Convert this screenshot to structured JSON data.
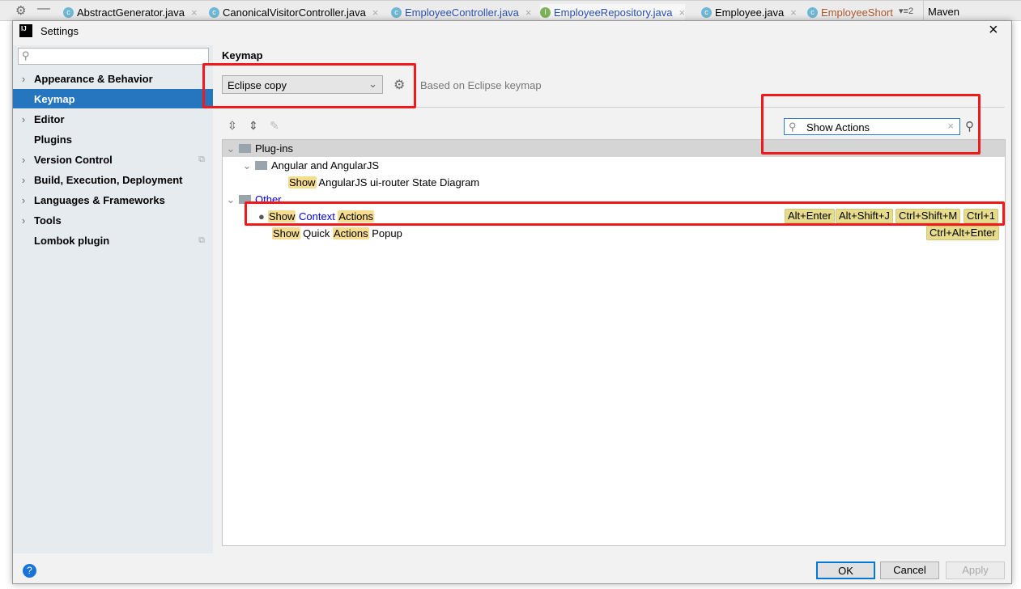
{
  "ide_tabs": [
    {
      "name": "AbstractGenerator.java",
      "kind": "C",
      "color": "#000000"
    },
    {
      "name": "CanonicalVisitorController.java",
      "kind": "C",
      "color": "#000000"
    },
    {
      "name": "EmployeeController.java",
      "kind": "C",
      "color": "#2a4fb5"
    },
    {
      "name": "EmployeeRepository.java",
      "kind": "I",
      "color": "#2a4fb5"
    },
    {
      "name": "Employee.java",
      "kind": "C",
      "color": "#000000"
    },
    {
      "name": "EmployeeShort",
      "kind": "C",
      "color": "#b0552a"
    }
  ],
  "tab_overflow": "▾≡2",
  "maven_label": "Maven",
  "dialog": {
    "title": "Settings",
    "logo": "IJ"
  },
  "sidebar": {
    "search_placeholder": "",
    "items": [
      {
        "label": "Appearance & Behavior",
        "expandable": true
      },
      {
        "label": "Keymap",
        "selected": true
      },
      {
        "label": "Editor",
        "expandable": true
      },
      {
        "label": "Plugins"
      },
      {
        "label": "Version Control",
        "expandable": true,
        "project_icon": true
      },
      {
        "label": "Build, Execution, Deployment",
        "expandable": true
      },
      {
        "label": "Languages & Frameworks",
        "expandable": true
      },
      {
        "label": "Tools",
        "expandable": true
      },
      {
        "label": "Lombok plugin",
        "project_icon": true
      }
    ]
  },
  "main": {
    "title": "Keymap",
    "keymap_select": "Eclipse copy",
    "based_on": "Based on Eclipse keymap",
    "search_value": "Show Actions",
    "tree": {
      "plugins": "Plug-ins",
      "angular": "Angular and AngularJS",
      "angular_action": {
        "hl": "Show",
        "rest": " AngularJS ui-router State Diagram"
      },
      "other": "Other",
      "context_actions": {
        "w1": "Show",
        "w2": " Context ",
        "w3": "Actions",
        "shortcuts": [
          "Alt+Enter",
          "Alt+Shift+J",
          "Ctrl+Shift+M",
          "Ctrl+1"
        ]
      },
      "quick_actions": {
        "w1": "Show",
        "w2": " Quick ",
        "w3": "Actions",
        "w4": " Popup",
        "shortcuts": [
          "Ctrl+Alt+Enter"
        ]
      }
    }
  },
  "buttons": {
    "ok": "OK",
    "cancel": "Cancel",
    "apply": "Apply",
    "help": "?"
  },
  "colors": {
    "selection": "#2675bf",
    "highlight": "#f5dc8f",
    "shortcut": "#e6dc8c",
    "annotation": "#f01a1a"
  }
}
